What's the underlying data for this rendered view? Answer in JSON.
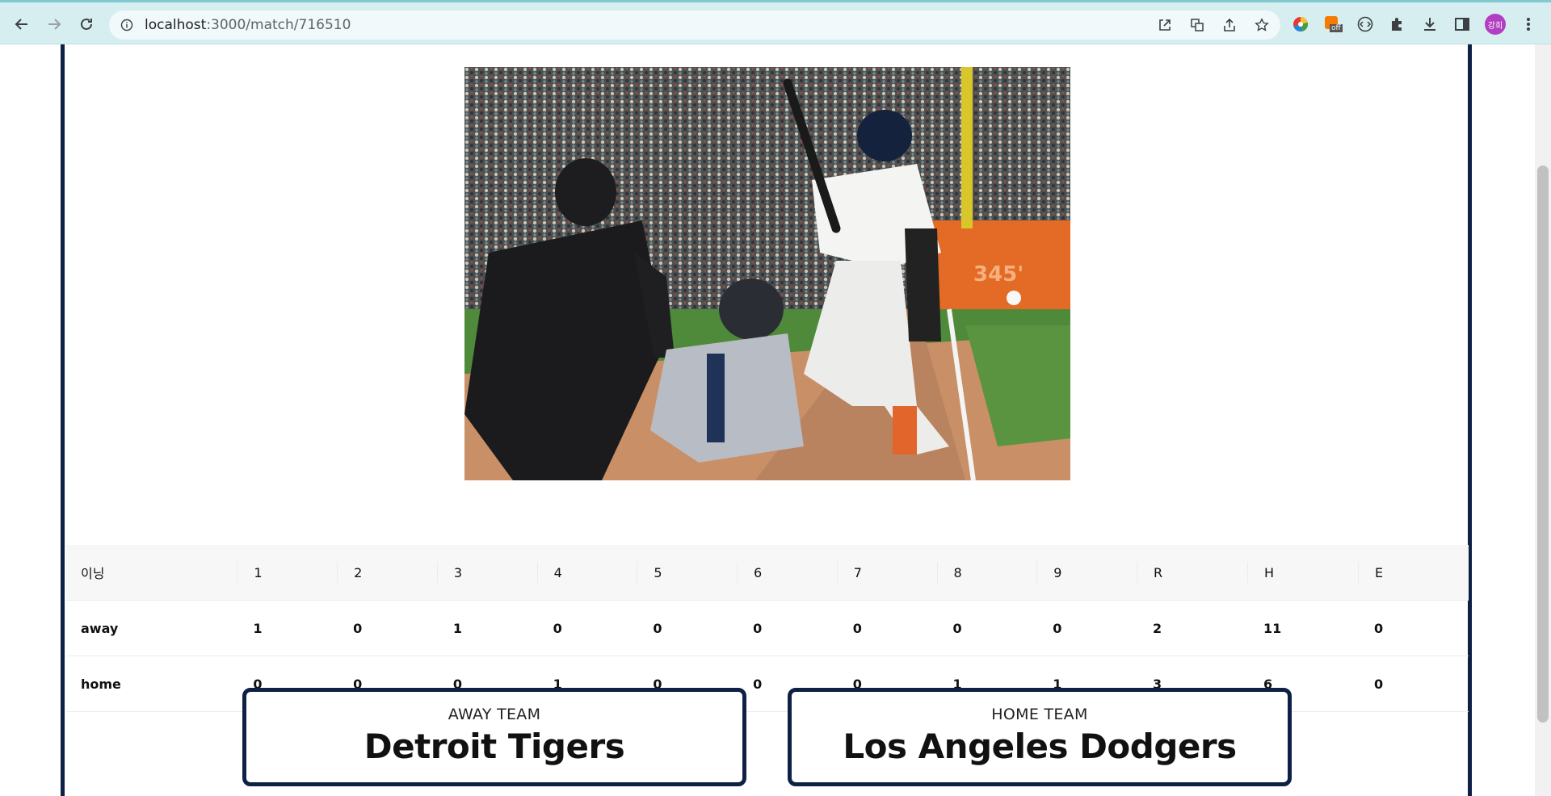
{
  "browser": {
    "url_host": "localhost",
    "url_path": ":3000/match/716510",
    "avatar_text": "강희",
    "ext_badge": "off"
  },
  "scoreboard": {
    "header_label": "이닝",
    "innings": [
      "1",
      "2",
      "3",
      "4",
      "5",
      "6",
      "7",
      "8",
      "9"
    ],
    "totals_headers": [
      "R",
      "H",
      "E"
    ],
    "rows": [
      {
        "team": "away",
        "innings": [
          "1",
          "0",
          "1",
          "0",
          "0",
          "0",
          "0",
          "0",
          "0"
        ],
        "totals": [
          "2",
          "11",
          "0"
        ]
      },
      {
        "team": "home",
        "innings": [
          "0",
          "0",
          "0",
          "1",
          "0",
          "0",
          "0",
          "1",
          "1"
        ],
        "totals": [
          "3",
          "6",
          "0"
        ]
      }
    ]
  },
  "away_team": {
    "role": "AWAY TEAM",
    "name": "Detroit Tigers"
  },
  "home_team": {
    "role": "HOME TEAM",
    "name": "Los Angeles Dodgers"
  },
  "photo": {
    "alt": "baseball batter at home plate with catcher and umpire"
  },
  "colors": {
    "accent": "#0f2045",
    "chrome": "#d6eef0"
  }
}
